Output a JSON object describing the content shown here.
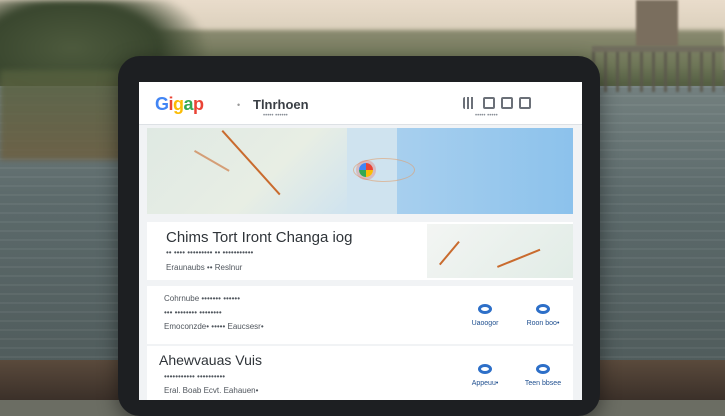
{
  "app": {
    "logo": [
      "G",
      "i",
      "g",
      "a",
      "p"
    ],
    "logo_dot": "•",
    "title": "Tlnrhoen",
    "subtitle": "••••• ••••••",
    "status_sub": "••••• •••••"
  },
  "colors": {
    "accent": "#2d6fc8",
    "map_route": "#c96b2e"
  },
  "card": {
    "title": "Chims Tort Iront Changa iog",
    "line1": "•• •••• ••••••••• •• •••••••••••",
    "line2": "Eraunaubs •• Reslnur"
  },
  "rows": [
    {
      "line1": "Cohrnube ••••••• ••••••",
      "line2": "••• •••••••• ••••••••",
      "line3": "Emoconzde• ••••• Eaucsesr•",
      "action1": "Uaoogor",
      "action2": "Roon boo•"
    },
    {
      "heading": "Ahewvauas Vuis",
      "line2": "••••••••••• ••••••••••",
      "line3": "Eral. Boab Ecvt. Eahauen•",
      "action1": "Appeuu•",
      "action2": "Teen bbsee"
    }
  ]
}
